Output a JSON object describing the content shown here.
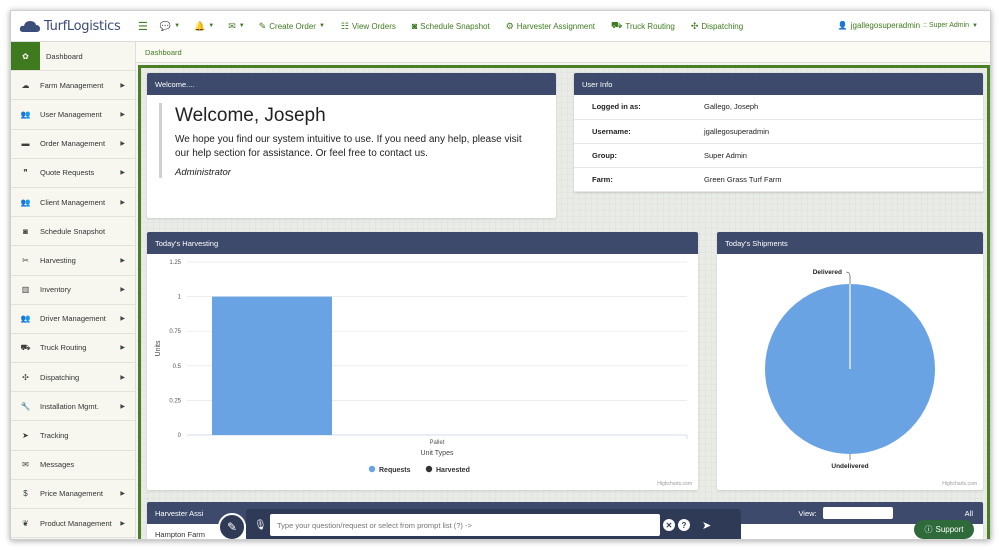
{
  "brand": {
    "name": "TurfLogistics"
  },
  "topnav": {
    "items": [
      {
        "label": "Create Order",
        "icon": "edit-icon"
      },
      {
        "label": "View Orders",
        "icon": "list-icon"
      },
      {
        "label": "Schedule Snapshot",
        "icon": "camera-icon"
      },
      {
        "label": "Harvester Assignment",
        "icon": "harvester-icon"
      },
      {
        "label": "Truck Routing",
        "icon": "truck-icon"
      },
      {
        "label": "Dispatching",
        "icon": "dispatch-icon"
      }
    ],
    "user": "jgallegosuperadmin",
    "role": ":: Super Admin"
  },
  "sidebar": {
    "items": [
      {
        "label": "Dashboard",
        "icon": "dashboard-icon",
        "arrow": false,
        "active": true
      },
      {
        "label": "Farm Management",
        "icon": "cloud-icon",
        "arrow": true
      },
      {
        "label": "User Management",
        "icon": "users-icon",
        "arrow": true
      },
      {
        "label": "Order Management",
        "icon": "card-icon",
        "arrow": true
      },
      {
        "label": "Quote Requests",
        "icon": "quote-icon",
        "arrow": true
      },
      {
        "label": "Client Management",
        "icon": "clients-icon",
        "arrow": true
      },
      {
        "label": "Schedule Snapshot",
        "icon": "camera-icon",
        "arrow": false
      },
      {
        "label": "Harvesting",
        "icon": "harvest-icon",
        "arrow": true
      },
      {
        "label": "Inventory",
        "icon": "bar-chart-icon",
        "arrow": true
      },
      {
        "label": "Driver Management",
        "icon": "drivers-icon",
        "arrow": true
      },
      {
        "label": "Truck Routing",
        "icon": "truck-icon",
        "arrow": true
      },
      {
        "label": "Dispatching",
        "icon": "dispatch-icon",
        "arrow": true
      },
      {
        "label": "Installation Mgmt.",
        "icon": "wrench-icon",
        "arrow": true
      },
      {
        "label": "Tracking",
        "icon": "location-arrow-icon",
        "arrow": false
      },
      {
        "label": "Messages",
        "icon": "envelope-icon",
        "arrow": false
      },
      {
        "label": "Price Management",
        "icon": "dollar-icon",
        "arrow": true
      },
      {
        "label": "Product Management",
        "icon": "leaf-icon",
        "arrow": true
      }
    ]
  },
  "breadcrumb": {
    "current": "Dashboard"
  },
  "welcome": {
    "header": "Welcome....",
    "title": "Welcome, Joseph",
    "text": "We hope you find our system intuitive to use. If you need any help, please visit our help section for assistance. Or feel free to contact us.",
    "role": "Administrator"
  },
  "userinfo": {
    "header": "User Info",
    "rows": [
      {
        "key": "Logged in as:",
        "value": "Gallego, Joseph"
      },
      {
        "key": "Username:",
        "value": "jgallegosuperadmin"
      },
      {
        "key": "Group:",
        "value": "Super Admin"
      },
      {
        "key": "Farm:",
        "value": "Green Grass Turf Farm"
      }
    ]
  },
  "harvesting": {
    "header": "Today's Harvesting",
    "credits": "Highcharts.com"
  },
  "shipments": {
    "header": "Today's Shipments",
    "credits": "Highcharts.com"
  },
  "harvester_panel": {
    "header": "Harvester Assi",
    "first_row": "Hampton Farm",
    "view_label": "View:",
    "right_label": "All"
  },
  "prompt": {
    "placeholder": "Type your question/request or select from prompt list (?) ->"
  },
  "support": {
    "label": "Support"
  },
  "colors": {
    "accent": "#3f7a1f",
    "header": "#3d4a6b",
    "bar": "#6aa3e3",
    "harvested": "#333333"
  },
  "chart_data": [
    {
      "type": "bar",
      "categories": [
        "Pallet"
      ],
      "series": [
        {
          "name": "Requests",
          "values": [
            1
          ],
          "color": "#6aa3e3"
        },
        {
          "name": "Harvested",
          "values": [
            0
          ],
          "color": "#333333"
        }
      ],
      "xlabel": "Unit Types",
      "ylabel": "Units",
      "ylim": [
        0,
        1.25
      ],
      "yticks": [
        "0",
        "0.25",
        "0.5",
        "0.75",
        "1",
        "1.25"
      ],
      "legend": "bottom-center"
    },
    {
      "type": "pie",
      "labels": [
        "Delivered",
        "Undelivered"
      ],
      "values": [
        0,
        1
      ],
      "colors": [
        "#6aa3e3",
        "#6aa3e3"
      ]
    }
  ]
}
